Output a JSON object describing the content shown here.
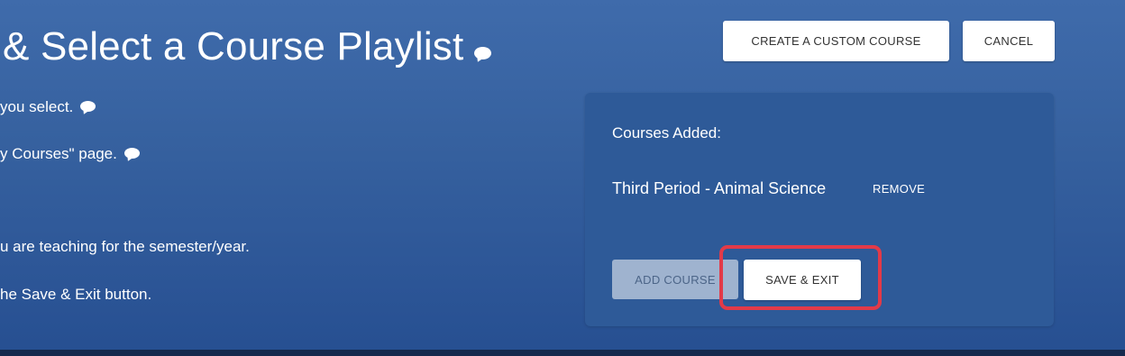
{
  "header": {
    "title": "& Select a Course Playlist",
    "create_custom_course_label": "CREATE A CUSTOM COURSE",
    "cancel_label": "CANCEL"
  },
  "instructions": [
    "you select.",
    "y Courses\" page.",
    "u are teaching for the semester/year.",
    "he Save & Exit button."
  ],
  "panel": {
    "heading": "Courses Added:",
    "courses": [
      {
        "name": "Third Period - Animal Science",
        "remove_label": "REMOVE"
      }
    ],
    "add_course_label": "ADD COURSE",
    "save_exit_label": "SAVE & EXIT"
  },
  "colors": {
    "background": "#36619f",
    "panel": "#2e5a98",
    "highlight": "#e23a48",
    "button_disabled": "#9fb3cf"
  },
  "icons": [
    "speech-bubble-icon"
  ]
}
